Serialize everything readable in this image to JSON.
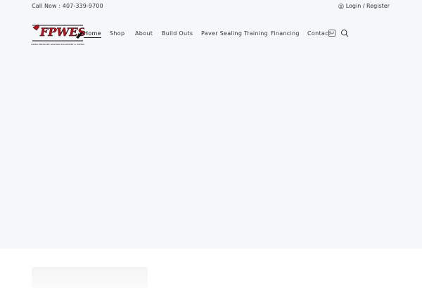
{
  "topbar": {
    "call_text": "Call Now : 407-339-9700",
    "login_text": "Login / Register"
  },
  "logo": {
    "text": "FPWES",
    "tagline": "FLORIDA PRESSURE WASHING EQUIPMENT & SUPPLIES",
    "accent": "#c0121b"
  },
  "nav": {
    "items": [
      "Home",
      "Shop",
      "About",
      "Build Outs",
      "Paver Sealing Training",
      "Financing",
      "Contact"
    ],
    "active": "Home"
  },
  "icons": {
    "login": "user-icon",
    "cart": "cart-icon",
    "search": "search-icon"
  }
}
